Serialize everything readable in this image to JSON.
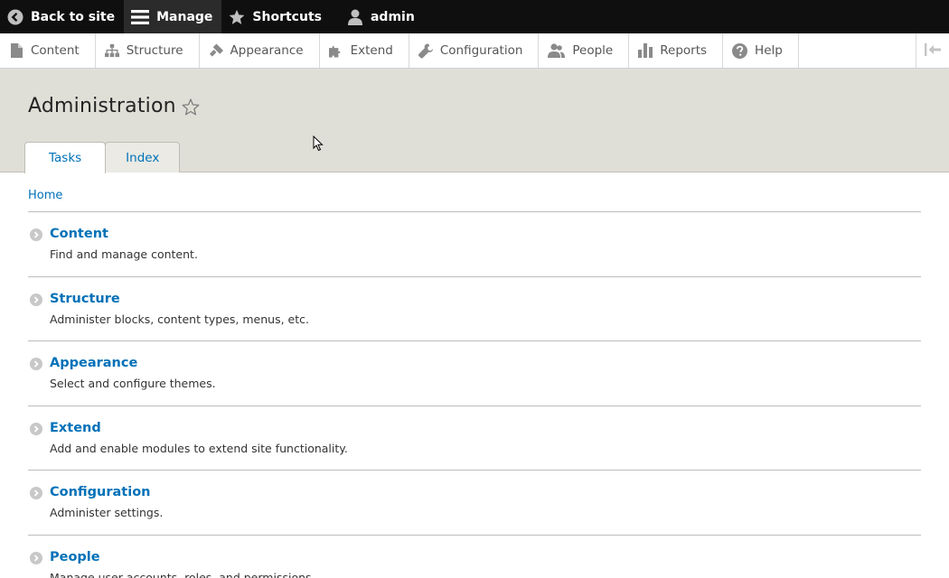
{
  "toolbar": {
    "back_to_site": "Back to site",
    "manage": "Manage",
    "shortcuts": "Shortcuts",
    "user": "admin"
  },
  "tray": {
    "items": [
      {
        "label": "Content",
        "icon": "file-icon"
      },
      {
        "label": "Structure",
        "icon": "sitemap-icon"
      },
      {
        "label": "Appearance",
        "icon": "paintbrush-icon"
      },
      {
        "label": "Extend",
        "icon": "puzzle-icon"
      },
      {
        "label": "Configuration",
        "icon": "wrench-icon"
      },
      {
        "label": "People",
        "icon": "people-icon"
      },
      {
        "label": "Reports",
        "icon": "bar-chart-icon"
      },
      {
        "label": "Help",
        "icon": "help-icon"
      }
    ]
  },
  "header": {
    "title": "Administration",
    "tabs": [
      {
        "label": "Tasks",
        "active": true
      },
      {
        "label": "Index",
        "active": false
      }
    ]
  },
  "breadcrumb": {
    "home": "Home"
  },
  "admin_items": [
    {
      "title": "Content",
      "description": "Find and manage content."
    },
    {
      "title": "Structure",
      "description": "Administer blocks, content types, menus, etc."
    },
    {
      "title": "Appearance",
      "description": "Select and configure themes."
    },
    {
      "title": "Extend",
      "description": "Add and enable modules to extend site functionality."
    },
    {
      "title": "Configuration",
      "description": "Administer settings."
    },
    {
      "title": "People",
      "description": "Manage user accounts, roles, and permissions."
    }
  ],
  "colors": {
    "link": "#0071b8",
    "toolbar_bg": "#0f0f0f",
    "header_bg": "#e0dfd7"
  }
}
